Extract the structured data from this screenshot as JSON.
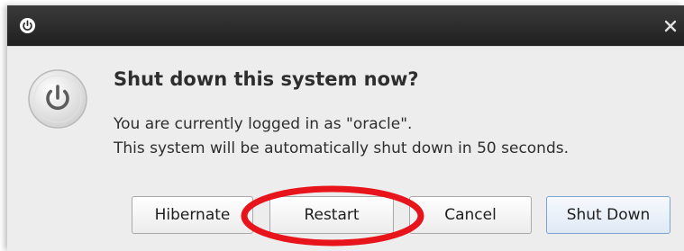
{
  "dialog": {
    "heading": "Shut down this system now?",
    "message_line1": "You are currently logged in as \"oracle\".",
    "message_line2": "This system will be automatically shut down in 50 seconds.",
    "close_symbol": "×"
  },
  "buttons": {
    "hibernate": "Hibernate",
    "restart": "Restart",
    "cancel": "Cancel",
    "shut_down": "Shut Down"
  },
  "icons": {
    "window_icon": "power-icon",
    "dialog_icon": "power-icon",
    "close": "close-icon"
  },
  "colors": {
    "titlebar": "#2a2a2a",
    "dialog_background": "#ededed",
    "annotation_ring": "#e8141c",
    "default_button_border": "#7ea4d1"
  }
}
